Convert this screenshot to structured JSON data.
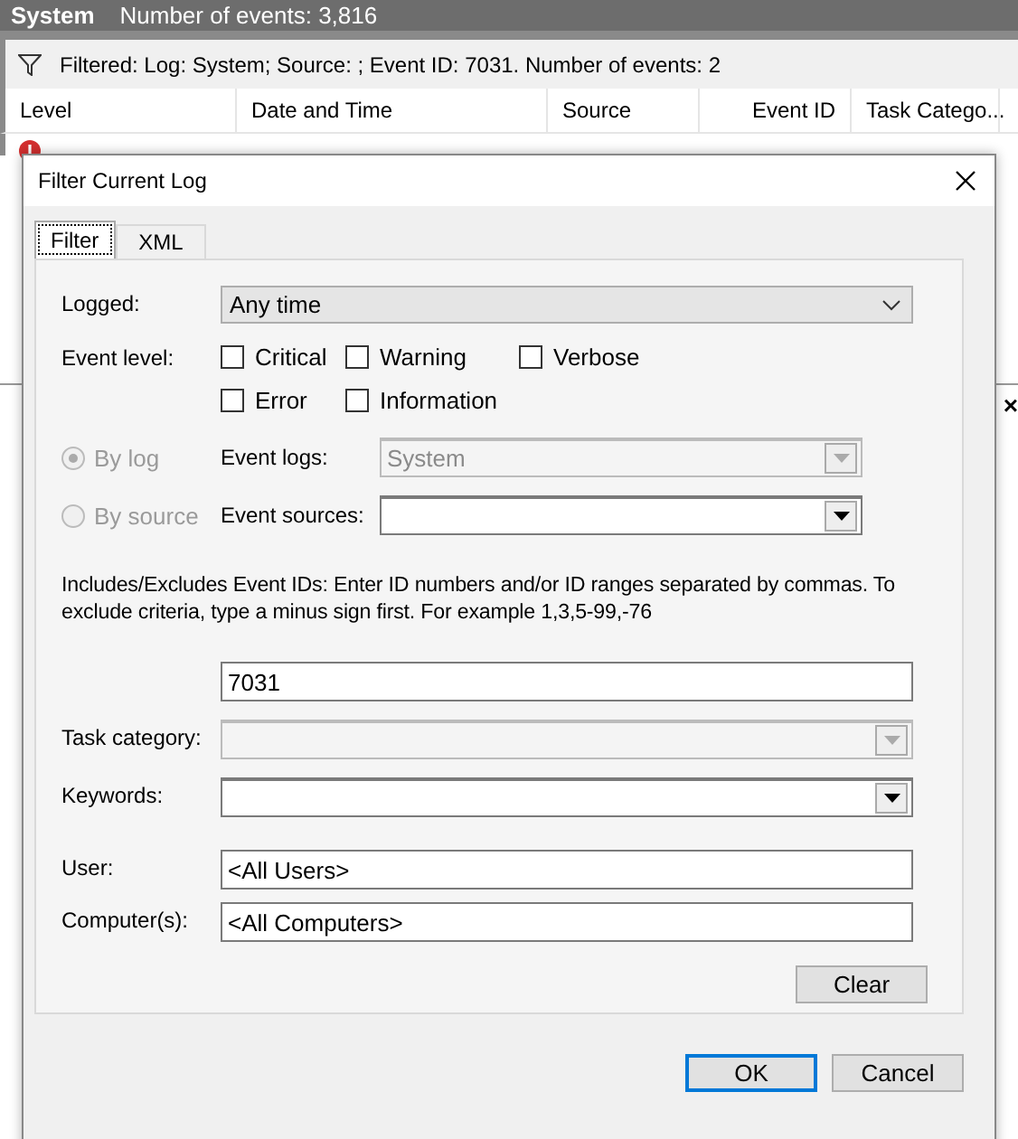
{
  "main_window": {
    "log_name": "System",
    "event_count": "Number of events: 3,816",
    "filter_summary": "Filtered: Log: System; Source: ; Event ID: 7031. Number of events: 2",
    "columns": [
      "Level",
      "Date and Time",
      "Source",
      "Event ID",
      "Task Catego..."
    ],
    "close_glyph": "×"
  },
  "dialog": {
    "title": "Filter Current Log",
    "tabs": [
      {
        "label": "Filter",
        "selected": true
      },
      {
        "label": "XML",
        "selected": false
      }
    ],
    "logged": {
      "label": "Logged:",
      "value": "Any time"
    },
    "event_level": {
      "label": "Event level:",
      "options": [
        {
          "label": "Critical",
          "checked": false
        },
        {
          "label": "Warning",
          "checked": false
        },
        {
          "label": "Verbose",
          "checked": false
        },
        {
          "label": "Error",
          "checked": false
        },
        {
          "label": "Information",
          "checked": false
        }
      ]
    },
    "scope": [
      {
        "label": "By log",
        "selected": true,
        "disabled": true,
        "field_label": "Event logs:",
        "value": "System",
        "field_disabled": true
      },
      {
        "label": "By source",
        "selected": false,
        "disabled": true,
        "field_label": "Event sources:",
        "field_disabled": false
      }
    ],
    "event_ids": {
      "description": "Includes/Excludes Event IDs: Enter ID numbers and/or ID ranges separated by commas. To exclude criteria, type a minus sign first. For example 1,3,5-99,-76",
      "value": "7031"
    },
    "task_category": {
      "label": "Task category:",
      "disabled": true
    },
    "keywords": {
      "label": "Keywords:",
      "disabled": false
    },
    "user": {
      "label": "User:",
      "value": "<All Users>"
    },
    "computers": {
      "label": "Computer(s):",
      "value": "<All Computers>"
    },
    "buttons": {
      "clear": "Clear",
      "ok": "OK",
      "cancel": "Cancel"
    }
  }
}
